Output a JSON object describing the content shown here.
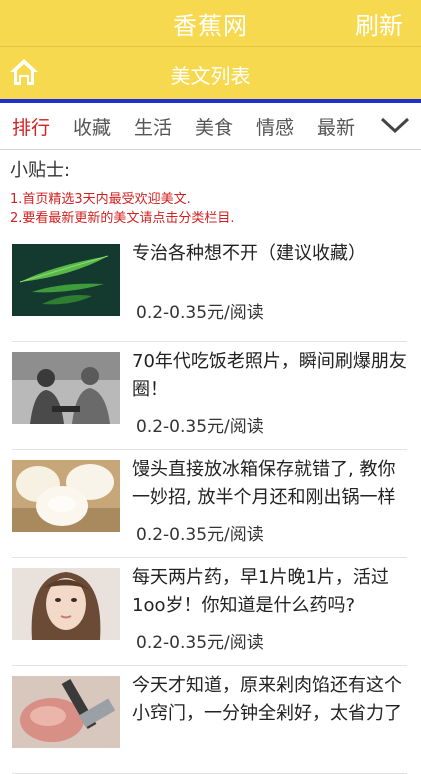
{
  "header": {
    "title": "香蕉网",
    "refresh_label": "刷新"
  },
  "subheader": {
    "title": "美文列表",
    "home_icon": "home-icon"
  },
  "tabs": [
    {
      "label": "排行",
      "active": true
    },
    {
      "label": "收藏",
      "active": false
    },
    {
      "label": "生活",
      "active": false
    },
    {
      "label": "美食",
      "active": false
    },
    {
      "label": "情感",
      "active": false
    },
    {
      "label": "最新",
      "active": false
    }
  ],
  "tips": {
    "heading": "小贴士:",
    "lines": [
      "1.首页精选3天内最受欢迎美文.",
      "2.要看最新更新的美文请点击分类栏目."
    ]
  },
  "articles": [
    {
      "title": "专治各种想不开（建议收藏）",
      "price": "0.2-0.35元/阅读",
      "thumb": "bamboo-leaf-image"
    },
    {
      "title": "70年代吃饭老照片，瞬间刷爆朋友圈！",
      "price": "0.2-0.35元/阅读",
      "thumb": "old-photo-image"
    },
    {
      "title": "馒头直接放冰箱保存就错了, 教你一妙招, 放半个月还和刚出锅一样",
      "price": "0.2-0.35元/阅读",
      "thumb": "steamed-buns-image"
    },
    {
      "title": "每天两片药，早1片晚1片，活过1oo岁！你知道是什么药吗?",
      "price": "0.2-0.35元/阅读",
      "thumb": "woman-portrait-image"
    },
    {
      "title": "今天才知道，原来剁肉馅还有这个小窍门，一分钟全剁好，太省力了",
      "price": "",
      "thumb": "minced-meat-image"
    }
  ],
  "colors": {
    "header_bg": "#f7d94f",
    "accent_red": "#d31f1f",
    "divider_blue": "#1e2fd0"
  }
}
